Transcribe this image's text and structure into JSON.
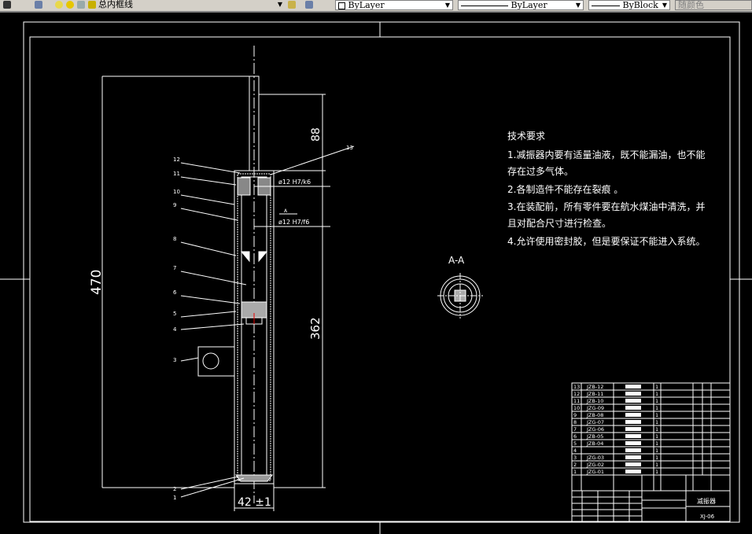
{
  "toolbar": {
    "layer_name": "总内框线",
    "color": "ByLayer",
    "linetype": "ByLayer",
    "lineweight": "ByBlock",
    "plot_style": "随颜色"
  },
  "drawing": {
    "dims": {
      "overall": "470",
      "top": "88",
      "body": "362",
      "width": "42 ±1",
      "fit1": "ø12 H7/k6",
      "fit2": "ø12 H7/f6",
      "section_mark": "A"
    },
    "balloons": [
      "12",
      "11",
      "10",
      "9",
      "8",
      "7",
      "6",
      "5",
      "4",
      "3",
      "2",
      "1",
      "13"
    ],
    "section_label": "A-A",
    "tech_req": {
      "title": "技术要求",
      "lines": [
        "1.减振器内要有适量油液，既不能漏油，也不能",
        "存在过多气体。",
        "2.各制造件不能存在裂痕 。",
        "3.在装配前，所有零件要在航水煤油中清洗，并",
        "且对配合尺寸进行检查。",
        "4.允许使用密封胶，但是要保证不能进入系统。"
      ]
    },
    "title_block": {
      "parts": [
        {
          "no": "13",
          "code": "JZB-12",
          "qty": "1"
        },
        {
          "no": "12",
          "code": "JZB-11",
          "qty": "1"
        },
        {
          "no": "11",
          "code": "JZB-10",
          "qty": "1"
        },
        {
          "no": "10",
          "code": "JZG-09",
          "qty": "1"
        },
        {
          "no": "9",
          "code": "JZB-08",
          "qty": "1"
        },
        {
          "no": "8",
          "code": "JZG-07",
          "qty": "1"
        },
        {
          "no": "7",
          "code": "JZG-06",
          "qty": "1"
        },
        {
          "no": "6",
          "code": "JZB-05",
          "qty": "1"
        },
        {
          "no": "5",
          "code": "JZB-04",
          "qty": "1"
        },
        {
          "no": "4",
          "code": "",
          "qty": "1"
        },
        {
          "no": "3",
          "code": "JZG-03",
          "qty": "1"
        },
        {
          "no": "2",
          "code": "JZG-02",
          "qty": "1"
        },
        {
          "no": "1",
          "code": "JZG-01",
          "qty": "1"
        }
      ],
      "name": "减振器",
      "drawing_no": "XJ-06"
    },
    "colors": {
      "background": "#000000",
      "lines": "#ffffff",
      "toolbar": "#d4d0c8"
    }
  }
}
